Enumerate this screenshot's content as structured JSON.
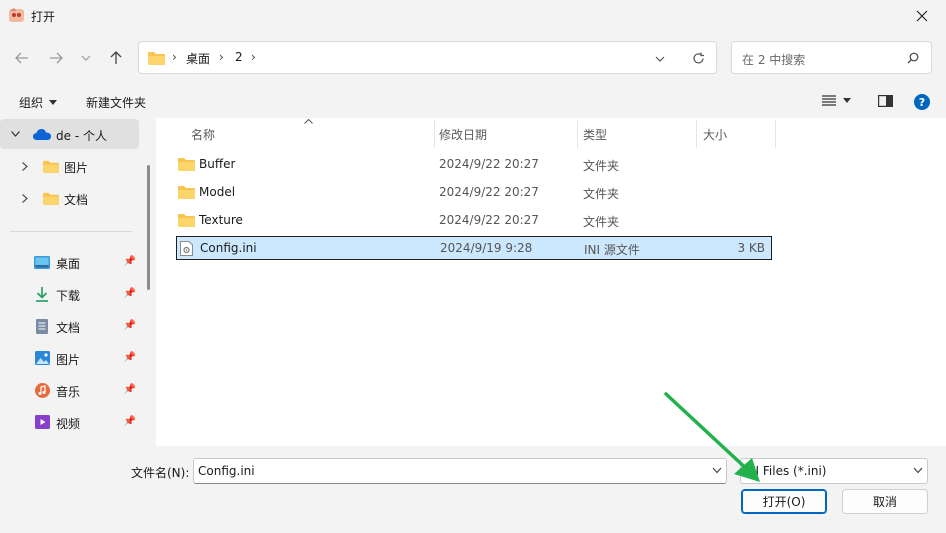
{
  "window": {
    "title": "打开"
  },
  "address": {
    "segments": [
      "桌面",
      "2"
    ]
  },
  "search": {
    "placeholder": "在 2 中搜索"
  },
  "toolbar": {
    "organize": "组织",
    "new_folder": "新建文件夹"
  },
  "sidebar": {
    "tree": [
      {
        "label": "de - 个人",
        "icon": "onedrive-cloud-icon",
        "expanded": true
      },
      {
        "label": "图片",
        "icon": "folder-icon"
      },
      {
        "label": "文档",
        "icon": "folder-icon"
      }
    ],
    "quick_access": [
      {
        "label": "桌面",
        "icon": "desktop-icon"
      },
      {
        "label": "下载",
        "icon": "download-icon"
      },
      {
        "label": "文档",
        "icon": "documents-icon"
      },
      {
        "label": "图片",
        "icon": "pictures-icon"
      },
      {
        "label": "音乐",
        "icon": "music-icon"
      },
      {
        "label": "视频",
        "icon": "videos-icon"
      }
    ]
  },
  "columns": {
    "name": "名称",
    "date": "修改日期",
    "type": "类型",
    "size": "大小"
  },
  "files": [
    {
      "name": "Buffer",
      "date": "2024/9/22 20:27",
      "type": "文件夹",
      "size": "",
      "icon": "folder-icon"
    },
    {
      "name": "Model",
      "date": "2024/9/22 20:27",
      "type": "文件夹",
      "size": "",
      "icon": "folder-icon"
    },
    {
      "name": "Texture",
      "date": "2024/9/22 20:27",
      "type": "文件夹",
      "size": "",
      "icon": "folder-icon"
    },
    {
      "name": "Config.ini",
      "date": "2024/9/19 9:28",
      "type": "INI 源文件",
      "size": "3 KB",
      "icon": "ini-file-icon",
      "selected": true
    }
  ],
  "footer": {
    "filename_label": "文件名(N):",
    "filename_value": "Config.ini",
    "filter_value": "INI Files (*.ini)",
    "open_label": "打开(O)",
    "cancel_label": "取消"
  },
  "colors": {
    "accent": "#0067c0",
    "selection": "#cce8ff",
    "folder": "#f8c44f",
    "arrow": "#22b14c"
  }
}
